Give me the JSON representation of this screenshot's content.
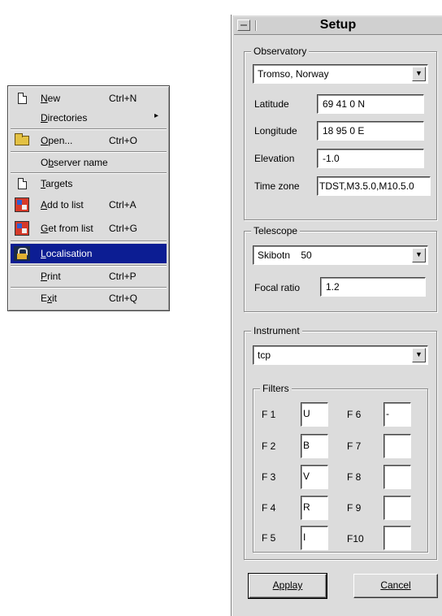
{
  "menu": {
    "items": [
      {
        "label": "New",
        "mnemonic": "N",
        "shortcut": "Ctrl+N",
        "icon": "document-icon"
      },
      {
        "label": "Directories",
        "mnemonic": "D",
        "shortcut": "",
        "icon": "",
        "submenu_arrow": "▸"
      },
      {
        "label": "Open...",
        "mnemonic": "O",
        "shortcut": "Ctrl+O",
        "icon": "folder-open-icon"
      },
      {
        "label": "Observer name",
        "mnemonic": "b",
        "shortcut": "",
        "icon": ""
      },
      {
        "label": "Targets",
        "mnemonic": "T",
        "shortcut": "",
        "icon": "document-icon"
      },
      {
        "label": "Add to list",
        "mnemonic": "A",
        "shortcut": "Ctrl+A",
        "icon": "grid-add-icon"
      },
      {
        "label": "Get from list",
        "mnemonic": "G",
        "shortcut": "Ctrl+G",
        "icon": "grid-get-icon"
      },
      {
        "label": "Localisation",
        "mnemonic": "L",
        "shortcut": "",
        "icon": "lock-icon",
        "selected": true
      },
      {
        "label": "Print",
        "mnemonic": "P",
        "shortcut": "Ctrl+P",
        "icon": ""
      },
      {
        "label": "Exit",
        "mnemonic": "x",
        "shortcut": "Ctrl+Q",
        "icon": ""
      }
    ]
  },
  "setup": {
    "title": "Setup",
    "observatory": {
      "group_title": "Observatory",
      "selected": "Tromso, Norway",
      "latitude_label": "Latitude",
      "latitude": "69 41  0 N",
      "longitude_label": "Longitude",
      "longitude": "18 95  0 E",
      "elevation_label": "Elevation",
      "elevation": "-1.0",
      "timezone_label": "Time zone",
      "timezone": "TDST,M3.5.0,M10.5.0"
    },
    "telescope": {
      "group_title": "Telescope",
      "selected": "Skibotn    50",
      "focal_ratio_label": "Focal ratio",
      "focal_ratio": "1.2"
    },
    "instrument": {
      "group_title": "Instrument",
      "selected": "tcp",
      "filters_title": "Filters",
      "filters_left": [
        {
          "label": "F 1",
          "value": "U"
        },
        {
          "label": "F 2",
          "value": "B"
        },
        {
          "label": "F 3",
          "value": "V"
        },
        {
          "label": "F 4",
          "value": "R"
        },
        {
          "label": "F 5",
          "value": "I"
        }
      ],
      "filters_right": [
        {
          "label": "F 6",
          "value": "-"
        },
        {
          "label": "F 7",
          "value": ""
        },
        {
          "label": "F 8",
          "value": ""
        },
        {
          "label": "F 9",
          "value": ""
        },
        {
          "label": "F10",
          "value": ""
        }
      ]
    },
    "apply_label": "Applay",
    "apply_mnemonic": "A",
    "cancel_label": "Cancel",
    "cancel_mnemonic": "C",
    "dropdown_arrow": "▼"
  }
}
